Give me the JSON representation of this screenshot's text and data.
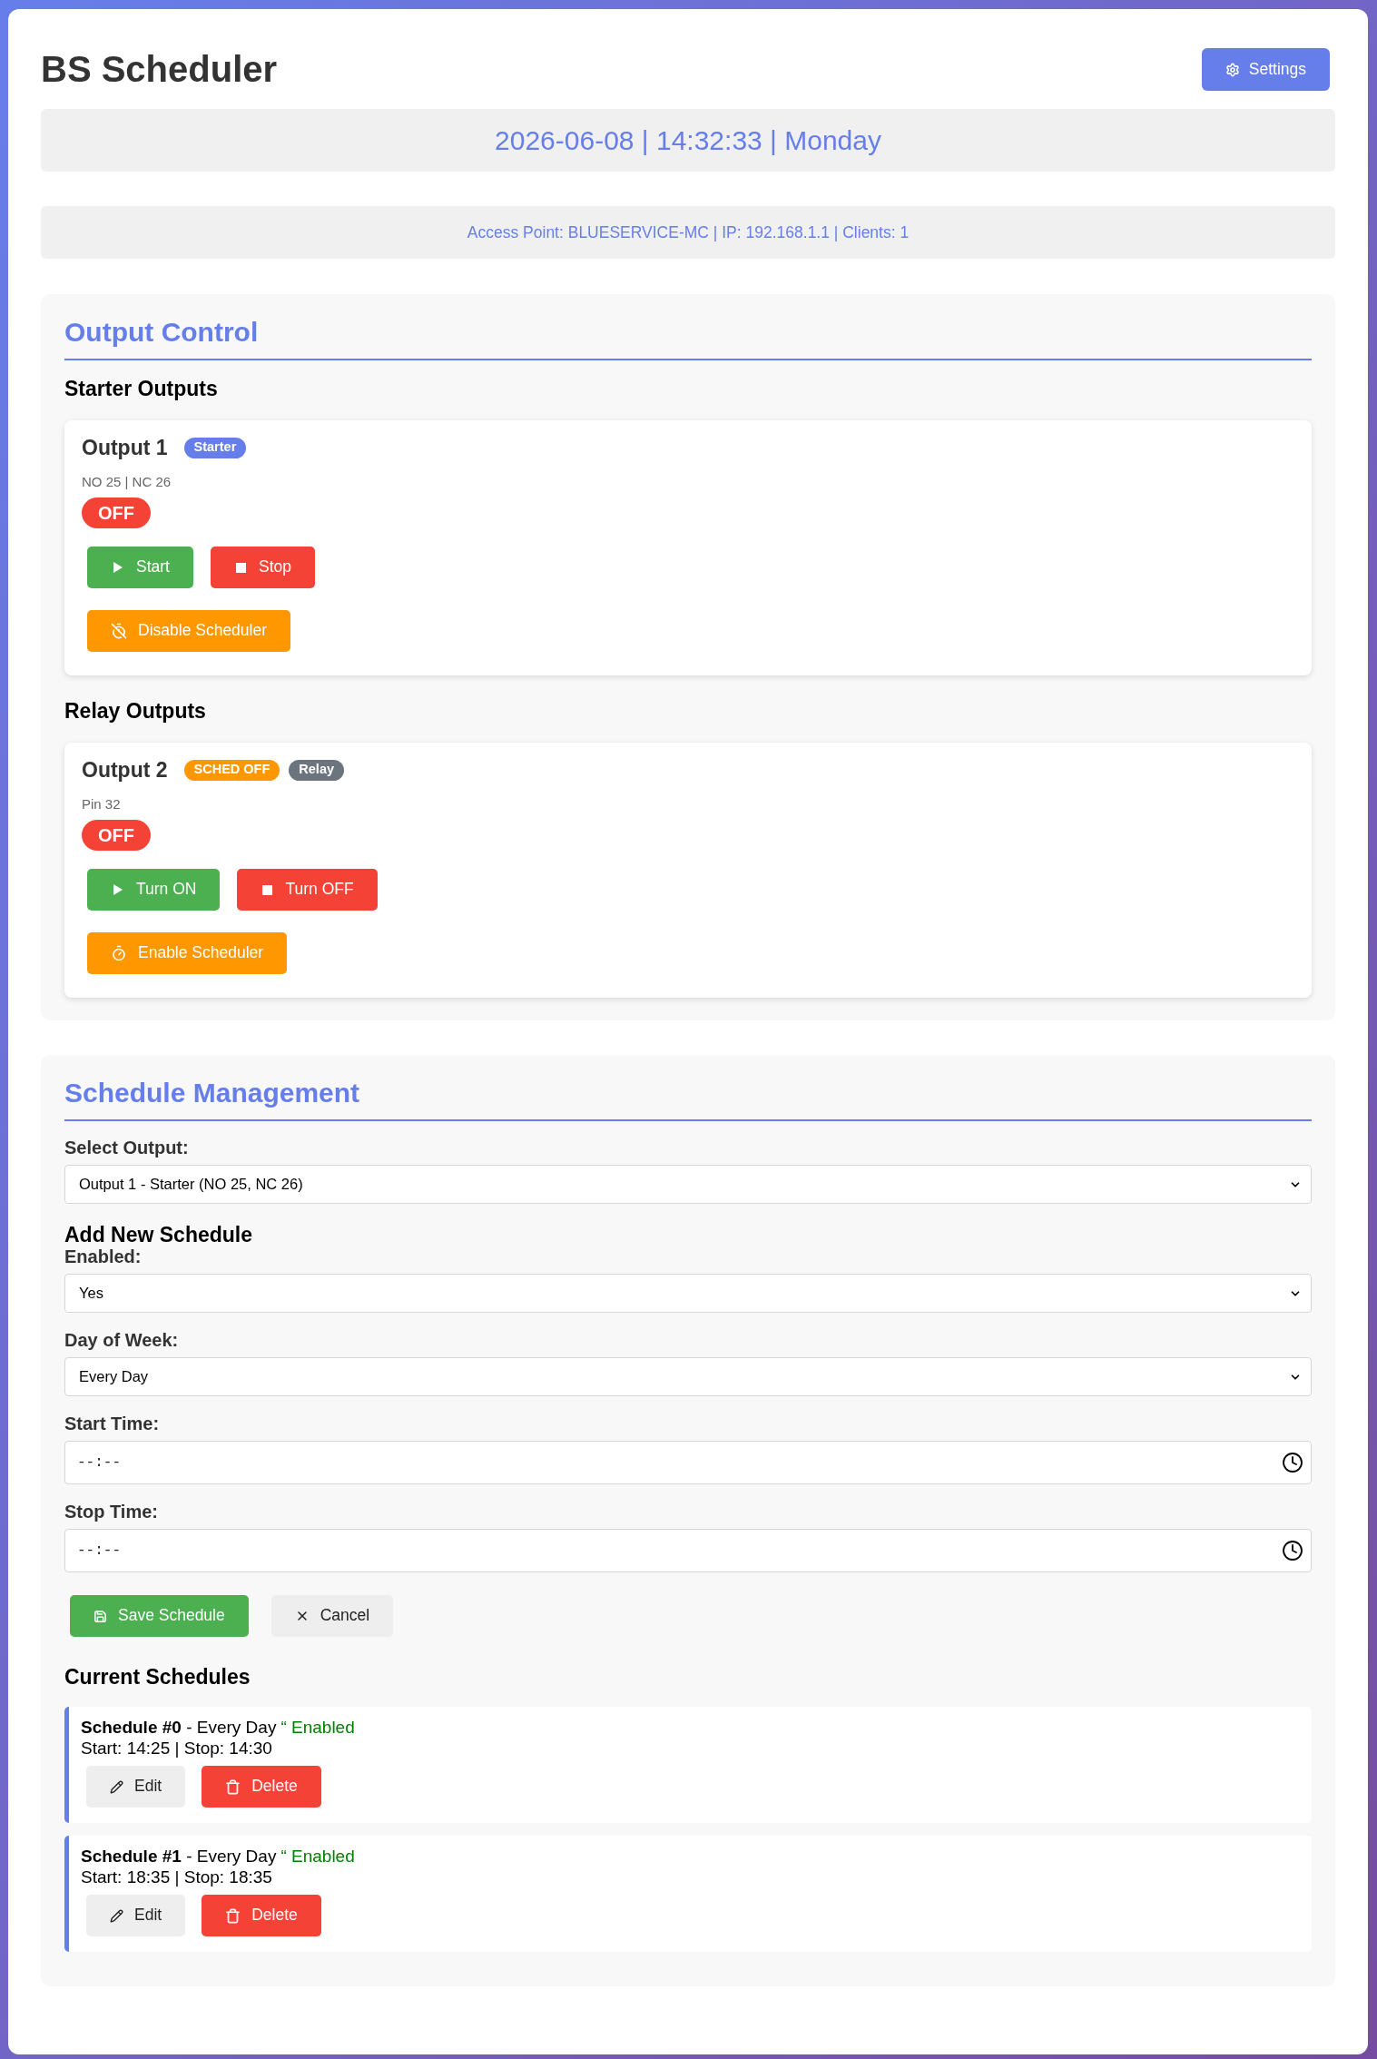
{
  "header": {
    "title": "BS Scheduler",
    "settings_button": "Settings"
  },
  "clock_bar": {
    "text": "2026-06-08 | 14:32:33 | Monday"
  },
  "network_bar": {
    "text": "Access Point: BLUESERVICE-MC | IP: 192.168.1.1 | Clients: 1"
  },
  "output_control": {
    "title": "Output Control",
    "groups": [
      {
        "title": "Starter Outputs",
        "outputs": [
          {
            "name": "Output 1",
            "badges": [
              {
                "text": "Starter",
                "color": "#667eea"
              }
            ],
            "pins": "NO 25 | NC 26",
            "status": {
              "label": "OFF",
              "on": false
            },
            "buttons": [
              {
                "label": "Start",
                "kind": "on"
              },
              {
                "label": "Stop",
                "kind": "off"
              }
            ],
            "scheduler_button": {
              "label": "Disable Scheduler",
              "kind": "disable"
            }
          }
        ]
      },
      {
        "title": "Relay Outputs",
        "outputs": [
          {
            "name": "Output 2",
            "badges": [
              {
                "text": "SCHED OFF",
                "color": "#ff9800"
              },
              {
                "text": "Relay",
                "color": "#6c757d"
              }
            ],
            "pins": "Pin 32",
            "status": {
              "label": "OFF",
              "on": false
            },
            "buttons": [
              {
                "label": "Turn ON",
                "kind": "on"
              },
              {
                "label": "Turn OFF",
                "kind": "off"
              }
            ],
            "scheduler_button": {
              "label": "Enable Scheduler",
              "kind": "enable"
            }
          }
        ]
      }
    ]
  },
  "schedule_management": {
    "title": "Schedule Management",
    "output_select": {
      "label": "Select Output:",
      "value": "Output 1 - Starter (NO 25, NC 26)"
    },
    "add_form": {
      "title": "Add New Schedule",
      "fields": [
        {
          "kind": "select",
          "label": "Enabled:",
          "value": "Yes"
        },
        {
          "kind": "select",
          "label": "Day of Week:",
          "value": "Every Day"
        },
        {
          "kind": "time",
          "label": "Start Time:",
          "placeholder": "--:--"
        },
        {
          "kind": "time",
          "label": "Stop Time:",
          "placeholder": "--:--"
        }
      ],
      "buttons": [
        {
          "label": "Save Schedule",
          "kind": "save"
        },
        {
          "label": "Cancel",
          "kind": "cancel"
        }
      ]
    },
    "current": {
      "title": "Current Schedules",
      "schedules": [
        {
          "title": "**Schedule #0** - Every Day",
          "status": "“ Enabled",
          "enabled": true,
          "times": "Start: 14:25 | Stop: 14:30",
          "buttons": [
            {
              "label": "Edit",
              "kind": "edit"
            },
            {
              "label": "Delete",
              "kind": "delete"
            }
          ]
        },
        {
          "title": "**Schedule #1** - Every Day",
          "status": "“ Enabled",
          "enabled": true,
          "times": "Start: 18:35 | Stop: 18:35",
          "buttons": [
            {
              "label": "Edit",
              "kind": "edit"
            },
            {
              "label": "Delete",
              "kind": "delete"
            }
          ]
        }
      ]
    }
  }
}
